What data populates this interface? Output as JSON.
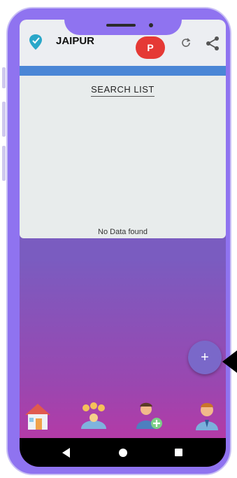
{
  "header": {
    "city": "JAIPUR",
    "avatar_letter": "P",
    "logo_icon": "location-pin-logo-icon",
    "refresh_icon": "refresh-icon",
    "share_icon": "share-icon"
  },
  "search": {
    "title": "SEARCH LIST",
    "empty_message": "No Data found"
  },
  "fab": {
    "label": "+"
  },
  "bottom_tabs": [
    {
      "icon": "home-icon"
    },
    {
      "icon": "group-icon"
    },
    {
      "icon": "add-user-icon"
    },
    {
      "icon": "profile-icon"
    }
  ],
  "system_nav": [
    "back",
    "home",
    "recents"
  ],
  "colors": {
    "frame": "#8f73f0",
    "appbar": "#eceef2",
    "accent_strip": "#4a86d6",
    "avatar": "#e53935",
    "fab": "#7a68c9",
    "gradient_top": "#7f63c2",
    "gradient_bottom": "#b33aa6"
  }
}
